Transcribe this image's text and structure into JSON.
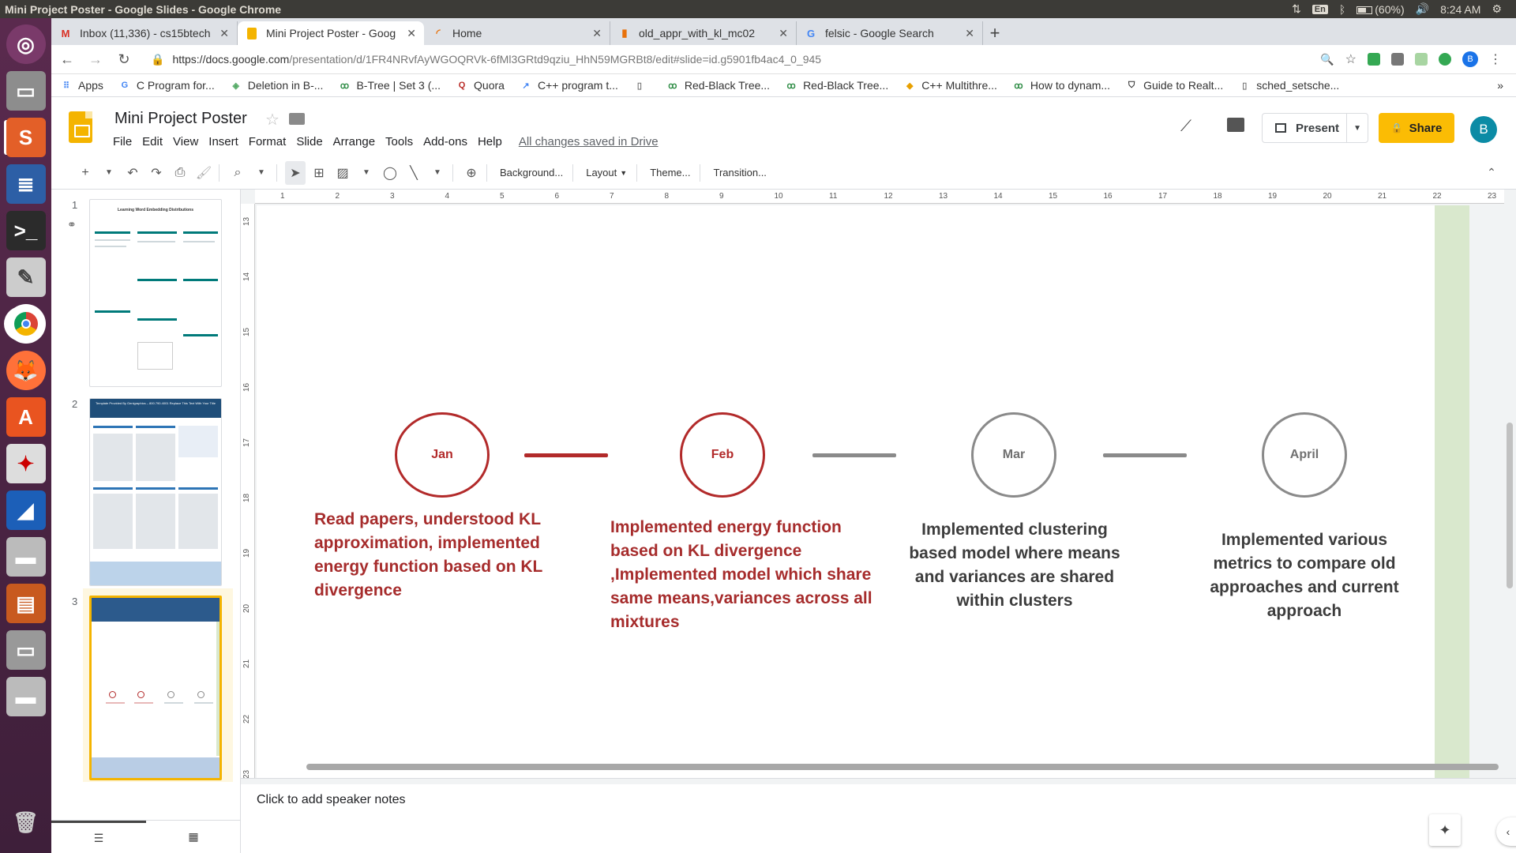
{
  "os": {
    "window_title": "Mini Project Poster - Google Slides - Google Chrome",
    "keyboard_layout": "En",
    "battery": "(60%)",
    "time": "8:24 AM"
  },
  "browser": {
    "tabs": [
      {
        "title": "Inbox (11,336) - cs15btech",
        "icon": "gmail-icon",
        "color": "#d93025"
      },
      {
        "title": "Mini Project Poster - Goog",
        "icon": "slides-icon",
        "color": "#f4b400"
      },
      {
        "title": "Home",
        "icon": "home-arc-icon",
        "color": "#e8710a"
      },
      {
        "title": "old_appr_with_kl_mc02",
        "icon": "notebook-icon",
        "color": "#e8710a"
      },
      {
        "title": "felsic - Google Search",
        "icon": "google-icon",
        "color": "#4285f4"
      }
    ],
    "url_main": "https://docs.google.com",
    "url_rest": "/presentation/d/1FR4NRvfAyWGOQRVk-6fMl3GRtd9qziu_HhN59MGRBt8/edit#slide=id.g5901fb4ac4_0_945",
    "bookmarks": [
      {
        "label": "Apps",
        "icon": "apps-grid-icon"
      },
      {
        "label": "C Program for...",
        "icon": "g-icon"
      },
      {
        "label": "Deletion in B-...",
        "icon": "bookmark-icon"
      },
      {
        "label": "B-Tree | Set 3 (...",
        "icon": "gfg-icon"
      },
      {
        "label": "Quora",
        "icon": "quora-icon"
      },
      {
        "label": "C++ program t...",
        "icon": "bookmark-icon"
      },
      {
        "label": "",
        "icon": "page-icon"
      },
      {
        "label": "Red-Black Tree...",
        "icon": "gfg-icon"
      },
      {
        "label": "Red-Black Tree...",
        "icon": "gfg-icon"
      },
      {
        "label": "C++ Multithre...",
        "icon": "bookmark-icon"
      },
      {
        "label": "How to dynam...",
        "icon": "gfg-icon"
      },
      {
        "label": "Guide to Realt...",
        "icon": "shield-icon"
      },
      {
        "label": "sched_setsche...",
        "icon": "page-icon"
      }
    ],
    "bookmarks_more": "»"
  },
  "slides": {
    "doc_title": "Mini Project Poster",
    "menu": [
      "File",
      "Edit",
      "View",
      "Insert",
      "Format",
      "Slide",
      "Arrange",
      "Tools",
      "Add-ons",
      "Help"
    ],
    "save_status": "All changes saved in Drive",
    "present_label": "Present",
    "share_label": "Share",
    "avatar_letter": "B",
    "toolbar": {
      "background": "Background...",
      "layout": "Layout",
      "theme": "Theme...",
      "transition": "Transition..."
    },
    "filmstrip": {
      "numbers": [
        "1",
        "2",
        "3"
      ],
      "thumb1_title": "Learning Word Embedding Distributions",
      "thumb2_title": "Template Provided By Genigraphics – 800.790.4001 Replace This Text With Your Title",
      "selected_slide": 3
    },
    "ruler": {
      "h_ticks": [
        "1",
        "2",
        "3",
        "4",
        "5",
        "6",
        "7",
        "8",
        "9",
        "10",
        "11",
        "12",
        "13",
        "14",
        "15",
        "16",
        "17",
        "18",
        "19",
        "20",
        "21",
        "22",
        "23"
      ],
      "v_ticks": [
        "13",
        "14",
        "15",
        "16",
        "17",
        "18",
        "19",
        "20",
        "21",
        "22",
        "23"
      ]
    },
    "timeline": [
      {
        "label": "Jan",
        "text": "Read papers, understood KL approximation, implemented energy function based on KL divergence",
        "style": "red"
      },
      {
        "label": "Feb",
        "text": "Implemented energy function based on KL divergence ,Implemented model which share same means,variances across all mixtures",
        "style": "red"
      },
      {
        "label": "Mar",
        "text": "Implemented clustering based model where means and variances are shared within clusters",
        "style": "gray"
      },
      {
        "label": "April",
        "text": "Implemented various metrics to compare old approaches and current approach",
        "style": "gray"
      }
    ],
    "notes_placeholder": "Click to add speaker notes",
    "colors": {
      "accent_red": "#b22a2a",
      "gray": "#8a8a8a",
      "slides_yellow": "#f4b400",
      "share_yellow": "#fbbc04",
      "slide_green_margin": "#d9e8cd"
    }
  }
}
